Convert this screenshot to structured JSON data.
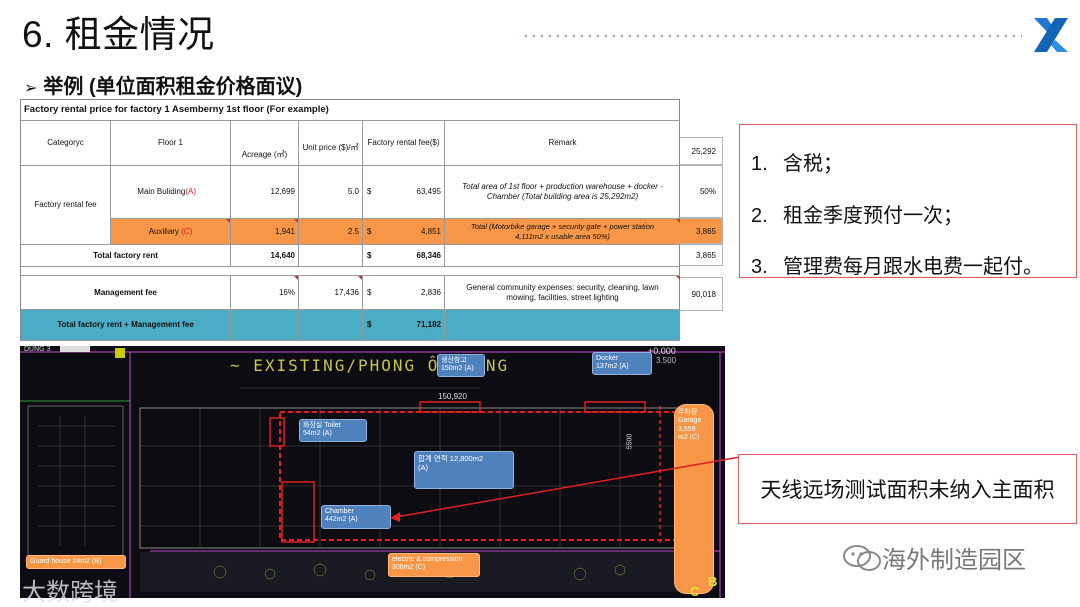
{
  "header": {
    "title": "6. 租金情况",
    "subtitle": "举例 (单位面积租金价格面议)",
    "subtitle_marker": "➢"
  },
  "table": {
    "title": "Factory rental price for factory 1 Asemberny 1st floor (For example)",
    "headers": {
      "category": "Categoryc",
      "floor": "Floor 1",
      "acreage": "Acreage (㎡)",
      "unit_price": "Unit price ($)/㎡",
      "fee": "Factory rental fee($)",
      "remark": "Remark"
    },
    "category_rent": "Factory rental fee",
    "currency": "$",
    "rows": {
      "main": {
        "floor": "Main Buliding",
        "tag": "(A)",
        "acreage": "12,699",
        "unit_price": "5.0",
        "fee": "63,495",
        "remark": "Total area of 1st floor + production warehouse + docker - Chamber (Total building area is 25,292m2)"
      },
      "aux": {
        "floor": "Auxiliary",
        "tag": "(C)",
        "acreage": "1,941",
        "unit_price": "2.5",
        "fee": "4,851",
        "remark": "Total (Motorbike garage + security gate + power station 4,111m2 x usable area 50%)"
      },
      "total": {
        "label": "Total factory rent",
        "acreage": "14,640",
        "fee": "68,346"
      },
      "mgmt": {
        "label": "Management fee",
        "rate": "16%",
        "base": "17,436",
        "fee": "2,836",
        "remark": "General community expenses: security, cleaning, lawn mowing, facilities, street lighting"
      },
      "grand": {
        "label": "Total factory rent + Management fee",
        "fee": "71,182"
      }
    },
    "side_values": [
      "25,292",
      "50%",
      "3,865",
      "3,865",
      "90,018"
    ]
  },
  "notes": [
    {
      "num": "1.",
      "text": "含税；"
    },
    {
      "num": "2.",
      "text": "租金季度预付一次；"
    },
    {
      "num": "3.",
      "text": "管理费每月跟水电费一起付。"
    }
  ],
  "map": {
    "banner": "~ EXISTING/PHONG ÔN  TRNG",
    "labels": {
      "warehouse": "생산창고\n150m2 (A)",
      "docker": "Docker\n137m2 (A)",
      "toilet": "화장실 Toilet\n54m2 (A)",
      "total_area": "합계 면적 12,800m2\n(A)",
      "chamber": "Chamber\n442m2 (A)",
      "garage": "주차장\nGarage\n3,559\nm2 (C)",
      "guard": "Guard house 24m2 (B)",
      "electric": "electric & compression\n306m2 (C)"
    },
    "dims": {
      "width": "150,920",
      "side": "5500",
      "level": "+0.000",
      "level2": "3.500"
    },
    "markers": {
      "b": "B",
      "c": "C"
    }
  },
  "callout": "天线远场测试面积未纳入主面积",
  "watermarks": {
    "wechat": "海外制造园区",
    "brand": "大数跨境"
  },
  "colors": {
    "orange": "#f79646",
    "teal": "#4bacc6",
    "red_border": "#e45b5b",
    "logo_blue": "#1f78d1"
  }
}
